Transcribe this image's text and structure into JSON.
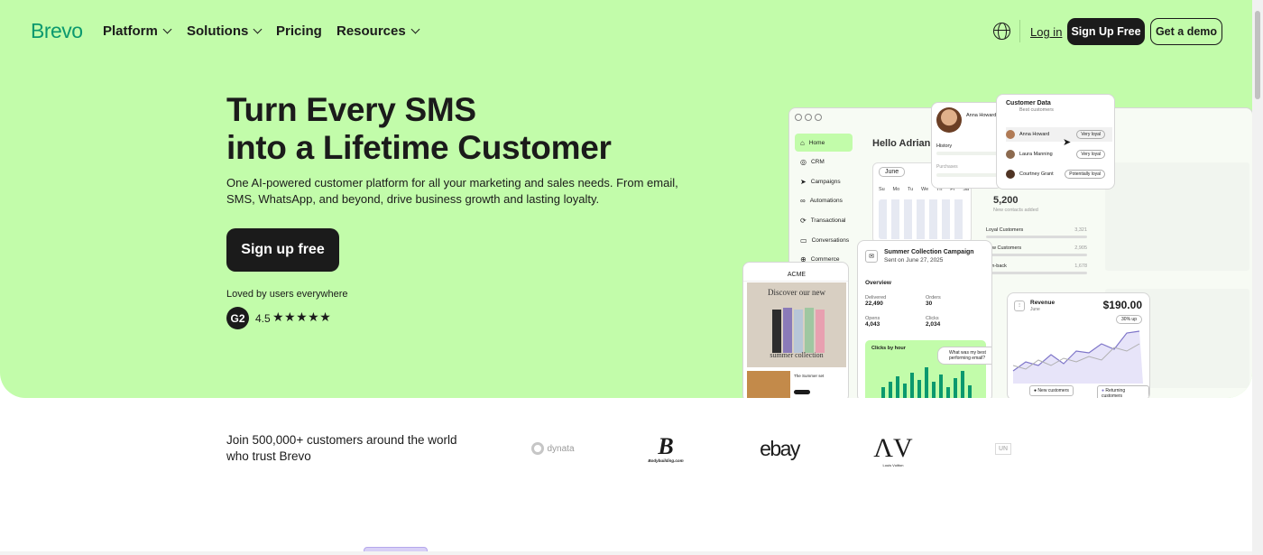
{
  "brand": {
    "name": "Brevo",
    "color": "#0b996e",
    "hero_bg": "#c2fcaa"
  },
  "nav": {
    "items": [
      {
        "label": "Platform",
        "dropdown": true
      },
      {
        "label": "Solutions",
        "dropdown": true
      },
      {
        "label": "Pricing",
        "dropdown": false
      },
      {
        "label": "Resources",
        "dropdown": true
      }
    ],
    "login": "Log in",
    "signup": "Sign Up Free",
    "demo": "Get a demo",
    "language_icon": "globe-icon"
  },
  "hero": {
    "title_line1": "Turn Every SMS",
    "title_line2": "into a Lifetime Customer",
    "subtitle": "One AI-powered customer platform for all your marketing and sales needs. From email, SMS, WhatsApp, and beyond, drive business growth and lasting loyalty.",
    "cta": "Sign up free",
    "loved": "Loved by users everywhere",
    "g2_label": "G2",
    "rating": "4.5",
    "stars": "★★★★★"
  },
  "mockup": {
    "sidebar": [
      "Home",
      "CRM",
      "Campaigns",
      "Automations",
      "Transactional",
      "Conversations",
      "Commerce"
    ],
    "greeting": "Hello Adrian",
    "calendar_month": "June",
    "calendar_days": [
      "Su",
      "Mo",
      "Tu",
      "We",
      "Th",
      "Fr",
      "Sa"
    ],
    "contacts_count": "5,200",
    "contacts_label": "New contacts added",
    "segments": [
      {
        "name": "Loyal Customers",
        "value": "3,321"
      },
      {
        "name": "New Customers",
        "value": "2,905"
      },
      {
        "name": "Win-back",
        "value": "1,678"
      }
    ],
    "profile": {
      "name": "Anna Howard",
      "history": "History",
      "purchases": "Purchases"
    },
    "customer_data": {
      "title": "Customer Data",
      "subtitle": "Best customers",
      "rows": [
        {
          "name": "Anna Howard",
          "badge": "Very loyal"
        },
        {
          "name": "Laura Manning",
          "badge": "Very loyal"
        },
        {
          "name": "Courtney Grant",
          "badge": "Potentially loyal"
        }
      ]
    },
    "campaign": {
      "title": "Summer Collection Campaign",
      "sent": "Sent on June 27, 2025",
      "overview": "Overview",
      "stats": [
        {
          "label": "Delivered",
          "value": "22,490"
        },
        {
          "label": "Orders",
          "value": "30"
        },
        {
          "label": "Opens",
          "value": "4,043"
        },
        {
          "label": "Clicks",
          "value": "2,034"
        }
      ],
      "clicks_by_hour": "Clicks by hour",
      "ai_prompt": "What was my best performing email?"
    },
    "phone": {
      "brand": "ACME",
      "banner": "Discover our new",
      "collection": "summer collection",
      "product": "The Summer set"
    },
    "revenue": {
      "title": "Revenue",
      "period": "June",
      "amount": "$190.00",
      "change": "30% up",
      "legend_new": "New customers",
      "legend_returning": "Returning customers"
    }
  },
  "trust": {
    "text": "Join 500,000+ customers around the world who trust Brevo",
    "logos": [
      "dynata",
      "Bodybuilding.com",
      "ebay",
      "Louis Vuitton",
      "UN"
    ]
  }
}
